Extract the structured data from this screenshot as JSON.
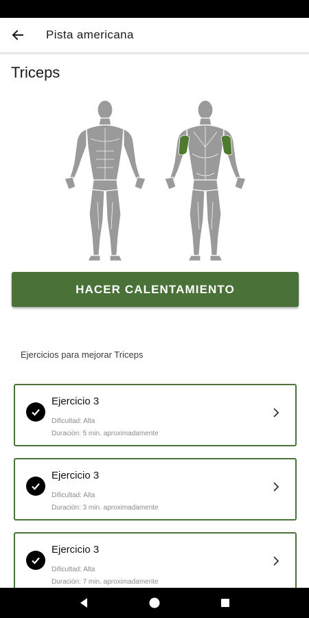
{
  "app_bar": {
    "title": "Pista americana",
    "back_icon": "arrow-left-icon"
  },
  "page": {
    "title": "Triceps"
  },
  "colors": {
    "accent": "#4a7138",
    "highlight_muscle": "#4d7a2f",
    "body": "#9a9a9a"
  },
  "body_map": {
    "front_icon": "body-front-icon",
    "back_icon": "body-back-icon",
    "highlighted_muscle": "Triceps"
  },
  "warmup_button": {
    "label": "HACER CALENTAMIENTO"
  },
  "section": {
    "label": "Ejercicios para mejorar Triceps"
  },
  "exercises": [
    {
      "title": "Ejercicio 3",
      "difficulty": "Dificultad: Alta",
      "duration": "Duración: 5 min. aproximadamente",
      "completed": true
    },
    {
      "title": "Ejercicio 3",
      "difficulty": "Dificultad: Alta",
      "duration": "Duración: 3 min. aproximadamente",
      "completed": true
    },
    {
      "title": "Ejercicio 3",
      "difficulty": "Dificultad: Alta",
      "duration": "Duración: 7 min. aproximadamente",
      "completed": true
    }
  ],
  "nav": {
    "back_icon": "nav-back-icon",
    "home_icon": "nav-home-icon",
    "recents_icon": "nav-recents-icon"
  }
}
